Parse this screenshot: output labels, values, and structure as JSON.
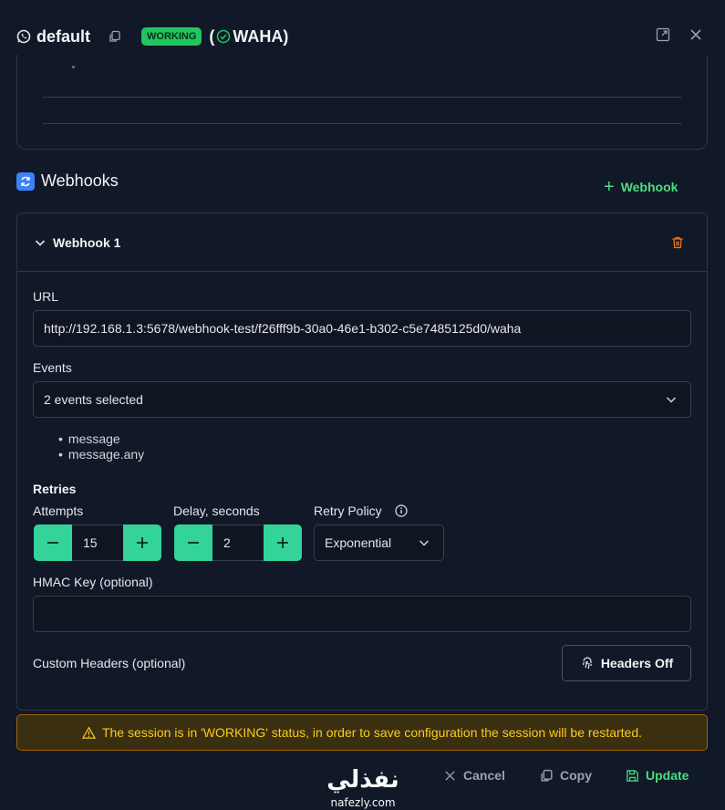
{
  "header": {
    "title": "default",
    "status_badge": "WORKING",
    "engine_open": "(",
    "engine_label": "WAHA)"
  },
  "webhooks": {
    "section_title": "Webhooks",
    "add_label": "Webhook",
    "item": {
      "title": "Webhook 1",
      "url_label": "URL",
      "url_value": "http://192.168.1.3:5678/webhook-test/f26fff9b-30a0-46e1-b302-c5e7485125d0/waha",
      "events_label": "Events",
      "events_selected": "2 events selected",
      "events": [
        "message",
        "message.any"
      ],
      "retries_label": "Retries",
      "attempts_label": "Attempts",
      "attempts_value": "15",
      "delay_label": "Delay, seconds",
      "delay_value": "2",
      "policy_label": "Retry Policy",
      "policy_value": "Exponential",
      "hmac_label": "HMAC Key (optional)",
      "hmac_value": "",
      "custom_headers_label": "Custom Headers (optional)",
      "headers_button": "Headers Off"
    }
  },
  "warning": "The session is in 'WORKING' status, in order to save configuration the session will be restarted.",
  "footer": {
    "cancel": "Cancel",
    "copy": "Copy",
    "update": "Update"
  },
  "watermark": {
    "arabic": "نفذلي",
    "latin": "nafezly.com"
  },
  "colors": {
    "background": "#111827",
    "accent_green": "#34d399",
    "badge_green": "#22c55e",
    "warning_yellow": "#facc15",
    "danger_orange": "#f97316"
  }
}
